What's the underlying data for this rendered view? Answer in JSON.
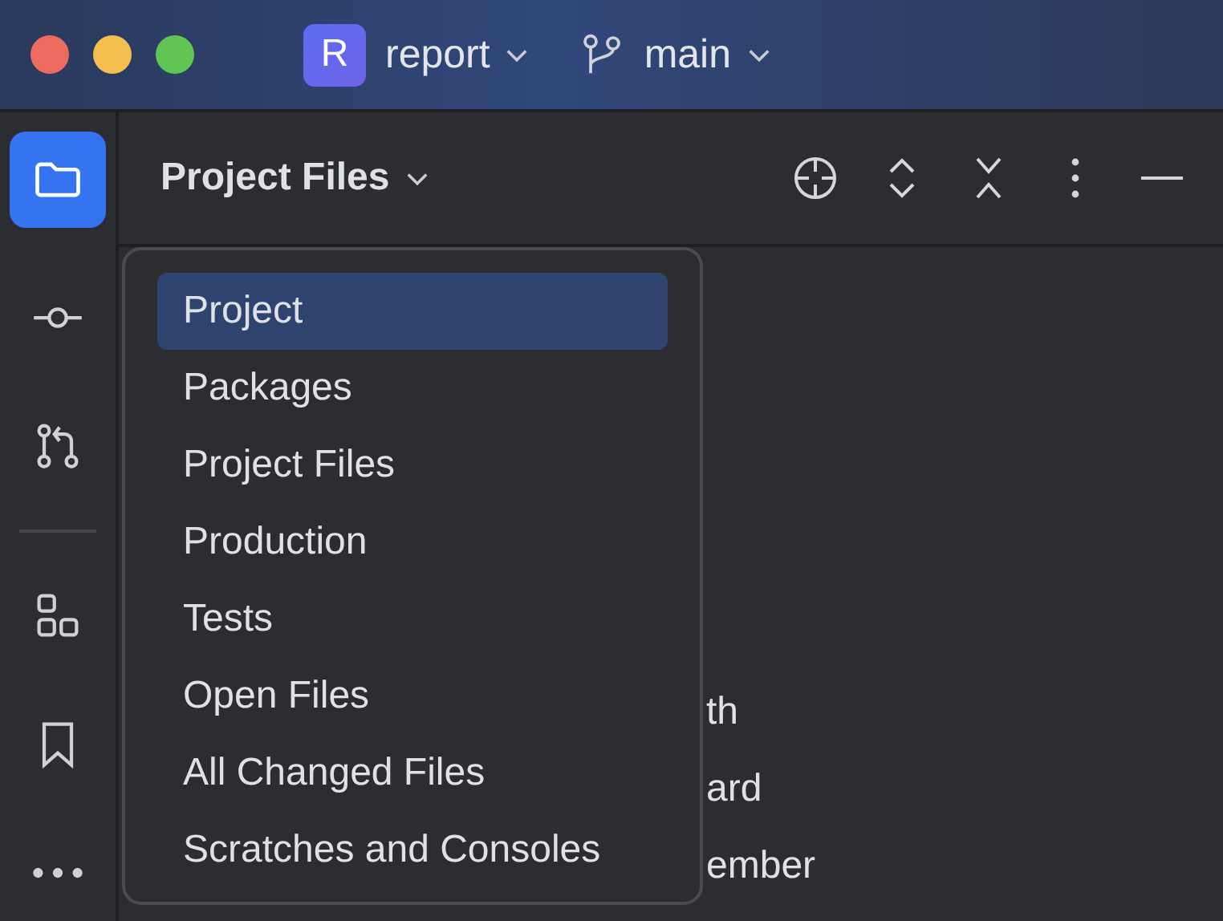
{
  "title_bar": {
    "project_badge": "R",
    "project": "report",
    "branch": "main"
  },
  "sidebar": {
    "items": [
      {
        "kind": "folder",
        "selected": true
      },
      {
        "kind": "commit",
        "selected": false
      },
      {
        "kind": "pull",
        "selected": false
      },
      {
        "kind": "divider"
      },
      {
        "kind": "structure",
        "selected": false
      },
      {
        "kind": "bookmark",
        "selected": false
      },
      {
        "kind": "more",
        "selected": false
      }
    ]
  },
  "panel": {
    "title": "Project Files",
    "tree_fragments": [
      "th",
      "ard",
      "ember"
    ]
  },
  "popup": {
    "items": [
      {
        "label": "Project",
        "selected": true
      },
      {
        "label": "Packages",
        "selected": false
      },
      {
        "label": "Project Files",
        "selected": false
      },
      {
        "label": "Production",
        "selected": false
      },
      {
        "label": "Tests",
        "selected": false
      },
      {
        "label": "Open Files",
        "selected": false
      },
      {
        "label": "All Changed Files",
        "selected": false
      },
      {
        "label": "Scratches and Consoles",
        "selected": false
      }
    ]
  }
}
